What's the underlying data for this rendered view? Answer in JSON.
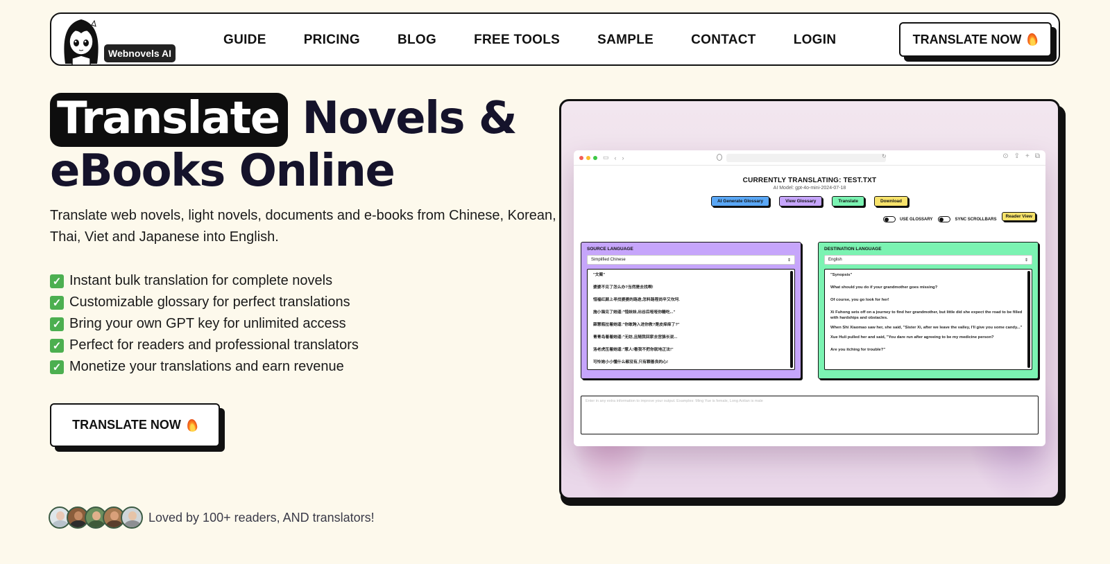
{
  "nav": {
    "logo_text": "Webnovels AI",
    "links": [
      "GUIDE",
      "PRICING",
      "BLOG",
      "FREE TOOLS",
      "SAMPLE",
      "CONTACT",
      "LOGIN"
    ],
    "cta_label": "TRANSLATE NOW"
  },
  "hero": {
    "title_highlight": "Translate",
    "title_rest_line1": "Novels &",
    "title_line2": "eBooks Online",
    "description": "Translate web novels, light novels, documents and e-books from Chinese, Korean, Thai, Viet and Japanese into English.",
    "features": [
      "Instant bulk translation for complete novels",
      "Customizable glossary for perfect translations",
      "Bring your own GPT key for unlimited access",
      "Perfect for readers and professional translators",
      "Monetize your translations and earn revenue"
    ],
    "cta_label": "TRANSLATE NOW",
    "social_text": "Loved by 100+ readers, AND translators!"
  },
  "app": {
    "title": "CURRENTLY TRANSLATING: TEST.TXT",
    "model": "AI Model: gpt-4o-mini-2024-07-18",
    "tools": [
      {
        "label": "AI Generate Glossary",
        "color": "#5aa7f5"
      },
      {
        "label": "View Glossary",
        "color": "#c6a5fb"
      },
      {
        "label": "Translate",
        "color": "#7bf3b2"
      },
      {
        "label": "Download",
        "color": "#f7e36b"
      }
    ],
    "toggle_glossary": "USE GLOSSARY",
    "toggle_scroll": "SYNC SCROLLBARS",
    "reader_view": "Reader View",
    "source": {
      "label": "SOURCE LANGUAGE",
      "selected": "Simplified Chinese",
      "lines": [
        "\"文案\"",
        "婆婆不见了怎么办?当然是去找啊!",
        "惜福红颜上寻找婆婆的路途,怎料路程尚辛又坎坷.",
        "施小猫见了她道:\"惜妹妹,出谷后哑哑你糖吃...\"",
        "薛慧瓶拉着她道:\"你敢跨入进你救?是皮痒痒了?\"",
        "青青岛着着她道:\"无妨,且随我回家去宫骆长说...",
        "洛老虎压着她道:\"惹人!看我不把你就地正法!\"",
        "可怜她小小懂什么都没有,只有颗善良的心!"
      ]
    },
    "destination": {
      "label": "DESTINATION LANGUAGE",
      "selected": "English",
      "lines": [
        "\"Synopsis\"",
        "What should you do if your grandmother goes missing?",
        "Of course, you go look for her!",
        "Xi Fuhong sets off on a journey to find her grandmother, but little did she expect the road to be filled with hardships and obstacles.",
        "When Shi Xiaomao saw her, she said, \"Sister Xi, after we leave the valley, I'll give you some candy...\"",
        "Xue Huli pulled her and said, \"You dare run after agreeing to be my medicine person?",
        "Are you itching for trouble?\""
      ]
    },
    "extra_placeholder": "Enter in any extra information to improve your output. Examples: Ming Yue is female, Long Aotian is male"
  },
  "colors": {
    "background": "#fdf9ec",
    "source_panel": "#c6a5fb",
    "destination_panel": "#7bf3b2"
  }
}
